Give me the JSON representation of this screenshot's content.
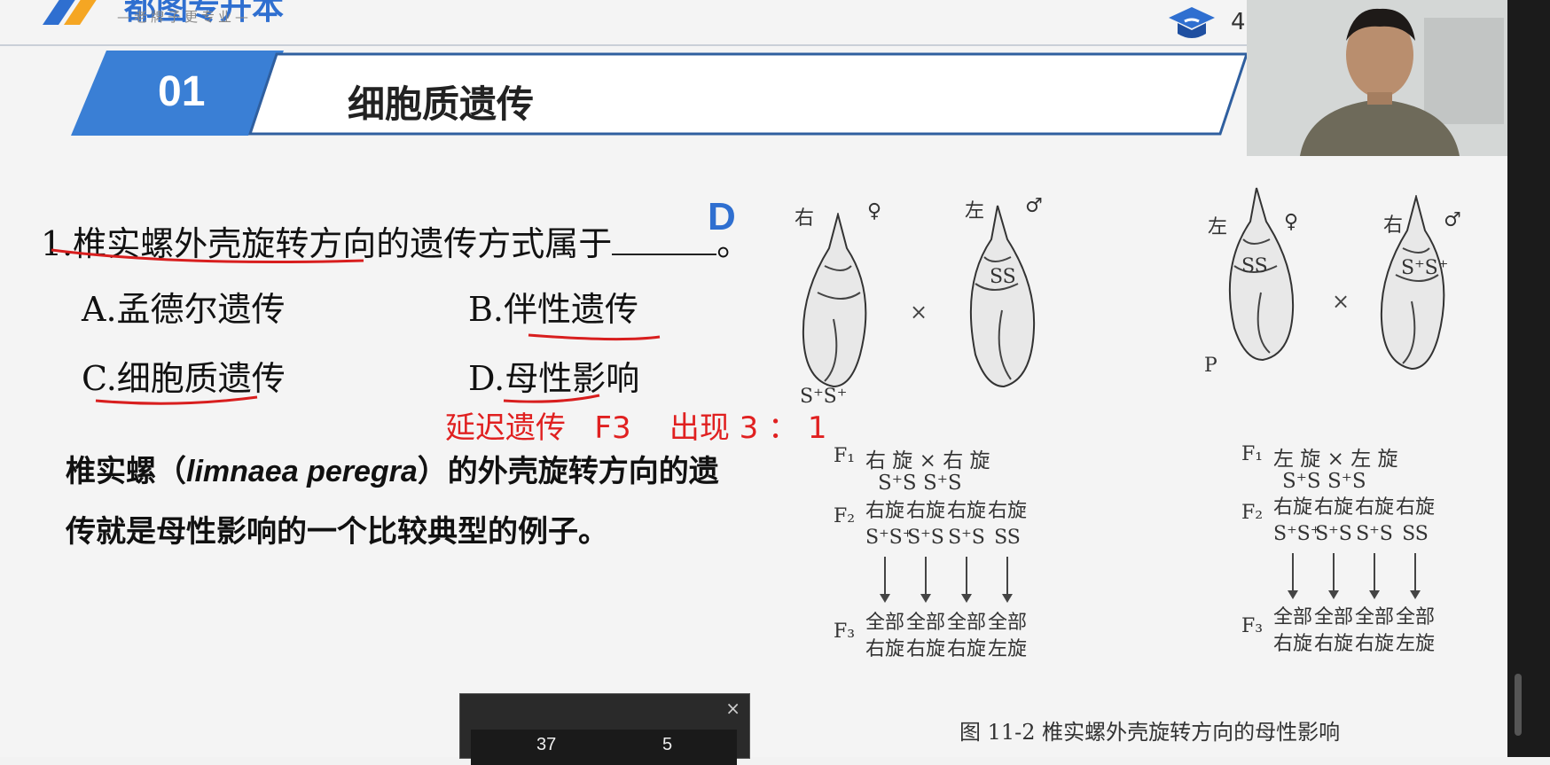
{
  "logo": {
    "name": "都图专升本",
    "tagline": "—老牌子更专业—"
  },
  "header": {
    "page_number": "4"
  },
  "section": {
    "number": "01",
    "title": "细胞质遗传"
  },
  "question": {
    "stem": "1.椎实螺外壳旋转方向的遗传方式属于",
    "end_mark": "。",
    "handwritten_answer": "D",
    "options": [
      {
        "label": "A.孟德尔遗传"
      },
      {
        "label": "B.伴性遗传"
      },
      {
        "label": "C.细胞质遗传"
      },
      {
        "label": "D.母性影响"
      }
    ],
    "annotation": "延迟遗传   F3    出现 3 ： 1"
  },
  "explanation": {
    "part1": "椎实螺（",
    "latin": "limnaea peregra",
    "part2": "）的外壳旋转方向的遗传就是母性影响的一个比较典型的例子。"
  },
  "diagram": {
    "left_cross": {
      "female_dir": "右",
      "female_sym": "♀",
      "female_genotype": "S⁺S⁺",
      "male_dir": "左",
      "male_sym": "♂",
      "male_genotype": "SS",
      "cross_symbol": "×",
      "f1_label": "F₁",
      "f1_row": "右  旋  ×  右  旋",
      "f1_genotypes": "S⁺S          S⁺S",
      "f2_label": "F₂",
      "f2_cols": [
        {
          "pheno": "右旋",
          "geno": "S⁺S⁺"
        },
        {
          "pheno": "右旋",
          "geno": "S⁺S"
        },
        {
          "pheno": "右旋",
          "geno": "S⁺S"
        },
        {
          "pheno": "右旋",
          "geno": "SS"
        }
      ],
      "f3_label": "F₃",
      "f3_cols": [
        {
          "line1": "全部",
          "line2": "右旋"
        },
        {
          "line1": "全部",
          "line2": "右旋"
        },
        {
          "line1": "全部",
          "line2": "右旋"
        },
        {
          "line1": "全部",
          "line2": "左旋"
        }
      ]
    },
    "right_cross": {
      "female_dir": "左",
      "female_sym": "♀",
      "female_genotype": "SS",
      "male_dir": "右",
      "male_sym": "♂",
      "male_genotype": "S⁺S⁺",
      "cross_symbol": "×",
      "p_label": "P",
      "f1_label": "F₁",
      "f1_row": "左  旋  ×  左  旋",
      "f1_genotypes": "S⁺S          S⁺S",
      "f2_label": "F₂",
      "f2_cols": [
        {
          "pheno": "右旋",
          "geno": "S⁺S⁺"
        },
        {
          "pheno": "右旋",
          "geno": "S⁺S"
        },
        {
          "pheno": "右旋",
          "geno": "S⁺S"
        },
        {
          "pheno": "右旋",
          "geno": "SS"
        }
      ],
      "f3_label": "F₃",
      "f3_cols": [
        {
          "line1": "全部",
          "line2": "右旋"
        },
        {
          "line1": "全部",
          "line2": "右旋"
        },
        {
          "line1": "全部",
          "line2": "右旋"
        },
        {
          "line1": "全部",
          "line2": "左旋"
        }
      ]
    },
    "caption": "图 11-2   椎实螺外壳旋转方向的母性影响"
  },
  "popup": {
    "close": "×",
    "value_left": "37",
    "value_right": "5"
  },
  "colors": {
    "accent_blue": "#2f6fd0",
    "annotation_red": "#e02020"
  }
}
